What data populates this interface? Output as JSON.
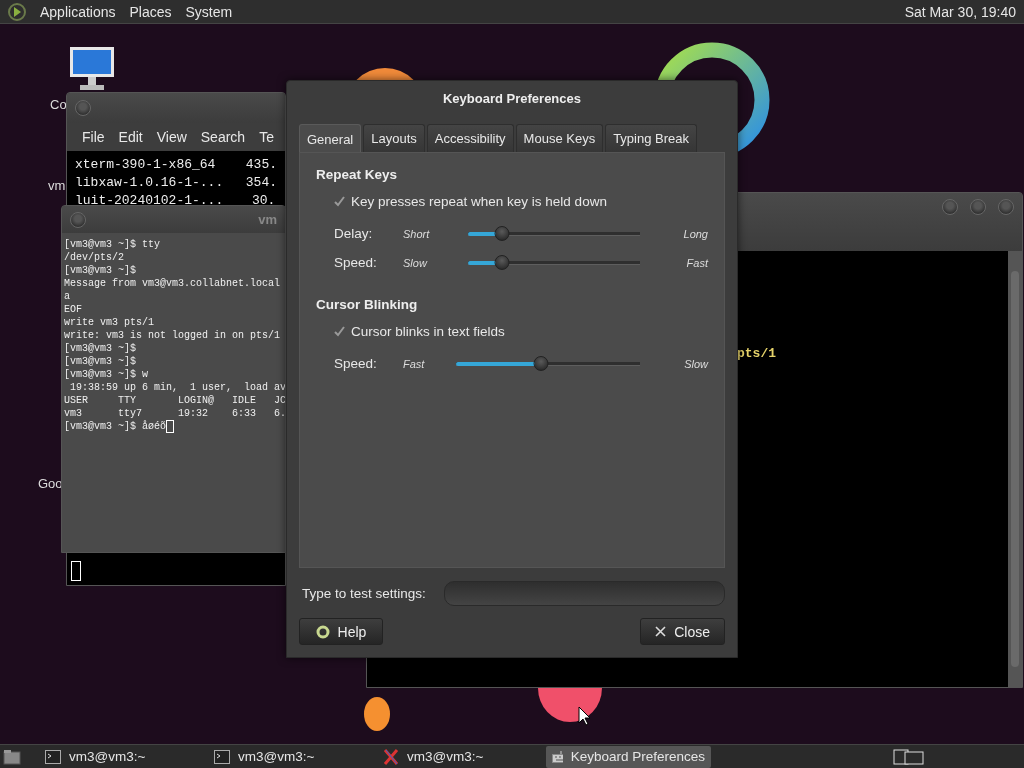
{
  "top_panel": {
    "menus": [
      "Applications",
      "Places",
      "System"
    ],
    "clock": "Sat Mar 30, 19:40"
  },
  "desktop_icons": [
    {
      "kind": "computer",
      "label": "Co"
    },
    {
      "kind": "label",
      "label": "vm"
    },
    {
      "kind": "label",
      "label": "Goo"
    }
  ],
  "file_window": {
    "menu": [
      "File",
      "Edit",
      "View",
      "Search",
      "Te"
    ],
    "rows": [
      {
        "name": "xterm-390-1-x86_64",
        "size": "435."
      },
      {
        "name": "libxaw-1.0.16-1-...",
        "size": "354."
      },
      {
        "name": "luit-20240102-1-...",
        "size": "30."
      }
    ]
  },
  "terminal_window": {
    "title": "vm",
    "lines": [
      "[vm3@vm3 ~]$ tty",
      "/dev/pts/2",
      "[vm3@vm3 ~]$",
      "Message from vm3@vm3.collabnet.local",
      "a",
      "EOF",
      "write vm3 pts/1",
      "write: vm3 is not logged in on pts/1",
      "[vm3@vm3 ~]$",
      "[vm3@vm3 ~]$",
      "[vm3@vm3 ~]$ w",
      " 19:38:59 up 6 min,  1 user,  load av",
      "USER     TTY       LOGIN@   IDLE   JC",
      "vm3      tty7      19:32    6:33   6.",
      "[vm3@vm3 ~]$ åøéõ"
    ]
  },
  "right_terminal": {
    "lines": [
      "pts/1"
    ]
  },
  "dialog": {
    "title": "Keyboard Preferences",
    "tabs": [
      {
        "label": "General",
        "selected": true
      },
      {
        "label": "Layouts",
        "selected": false
      },
      {
        "label": "Accessibility",
        "selected": false
      },
      {
        "label": "Mouse Keys",
        "selected": false
      },
      {
        "label": "Typing Break",
        "selected": false
      }
    ],
    "sections": [
      {
        "title": "Repeat Keys",
        "checkbox": {
          "label": "Key presses repeat when key is held down",
          "checked": true
        },
        "sliders": [
          {
            "label": "Delay:",
            "min_label": "Short",
            "max_label": "Long",
            "level": 0.2
          },
          {
            "label": "Speed:",
            "min_label": "Slow",
            "max_label": "Fast",
            "level": 0.2
          }
        ]
      },
      {
        "title": "Cursor Blinking",
        "checkbox": {
          "label": "Cursor blinks in text fields",
          "checked": true
        },
        "sliders": [
          {
            "label": "Speed:",
            "min_label": "Fast",
            "max_label": "Slow",
            "level": 0.46
          }
        ]
      }
    ],
    "test_label": "Type to test settings:",
    "buttons": [
      {
        "kind": "help",
        "label": "Help"
      },
      {
        "kind": "close",
        "label": "Close"
      }
    ]
  },
  "taskbar": {
    "tasks": [
      {
        "kind": "terminal",
        "label": "vm3@vm3:~",
        "selected": false
      },
      {
        "kind": "terminal",
        "label": "vm3@vm3:~",
        "selected": false
      },
      {
        "kind": "x",
        "label": "vm3@vm3:~",
        "selected": false
      },
      {
        "kind": "keyboard",
        "label": "Keyboard Preferences",
        "selected": true
      }
    ]
  }
}
